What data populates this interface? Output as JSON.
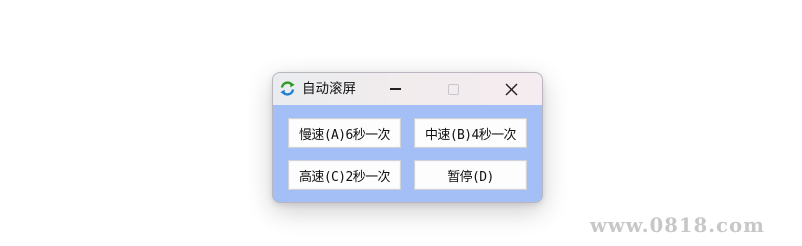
{
  "window": {
    "title": "自动滚屏",
    "icon": "refresh-arrows-icon",
    "controls": {
      "minimize_icon": "minimize-icon",
      "maximize_icon": "maximize-icon",
      "close_icon": "close-icon",
      "maximize_enabled": false
    },
    "background_color": "#a4bff5"
  },
  "buttons": [
    {
      "label": "慢速(A)6秒一次"
    },
    {
      "label": "中速(B)4秒一次"
    },
    {
      "label": "高速(C)2秒一次"
    },
    {
      "label": "暂停(D)"
    }
  ],
  "watermark": {
    "text": "www.0818.com"
  }
}
